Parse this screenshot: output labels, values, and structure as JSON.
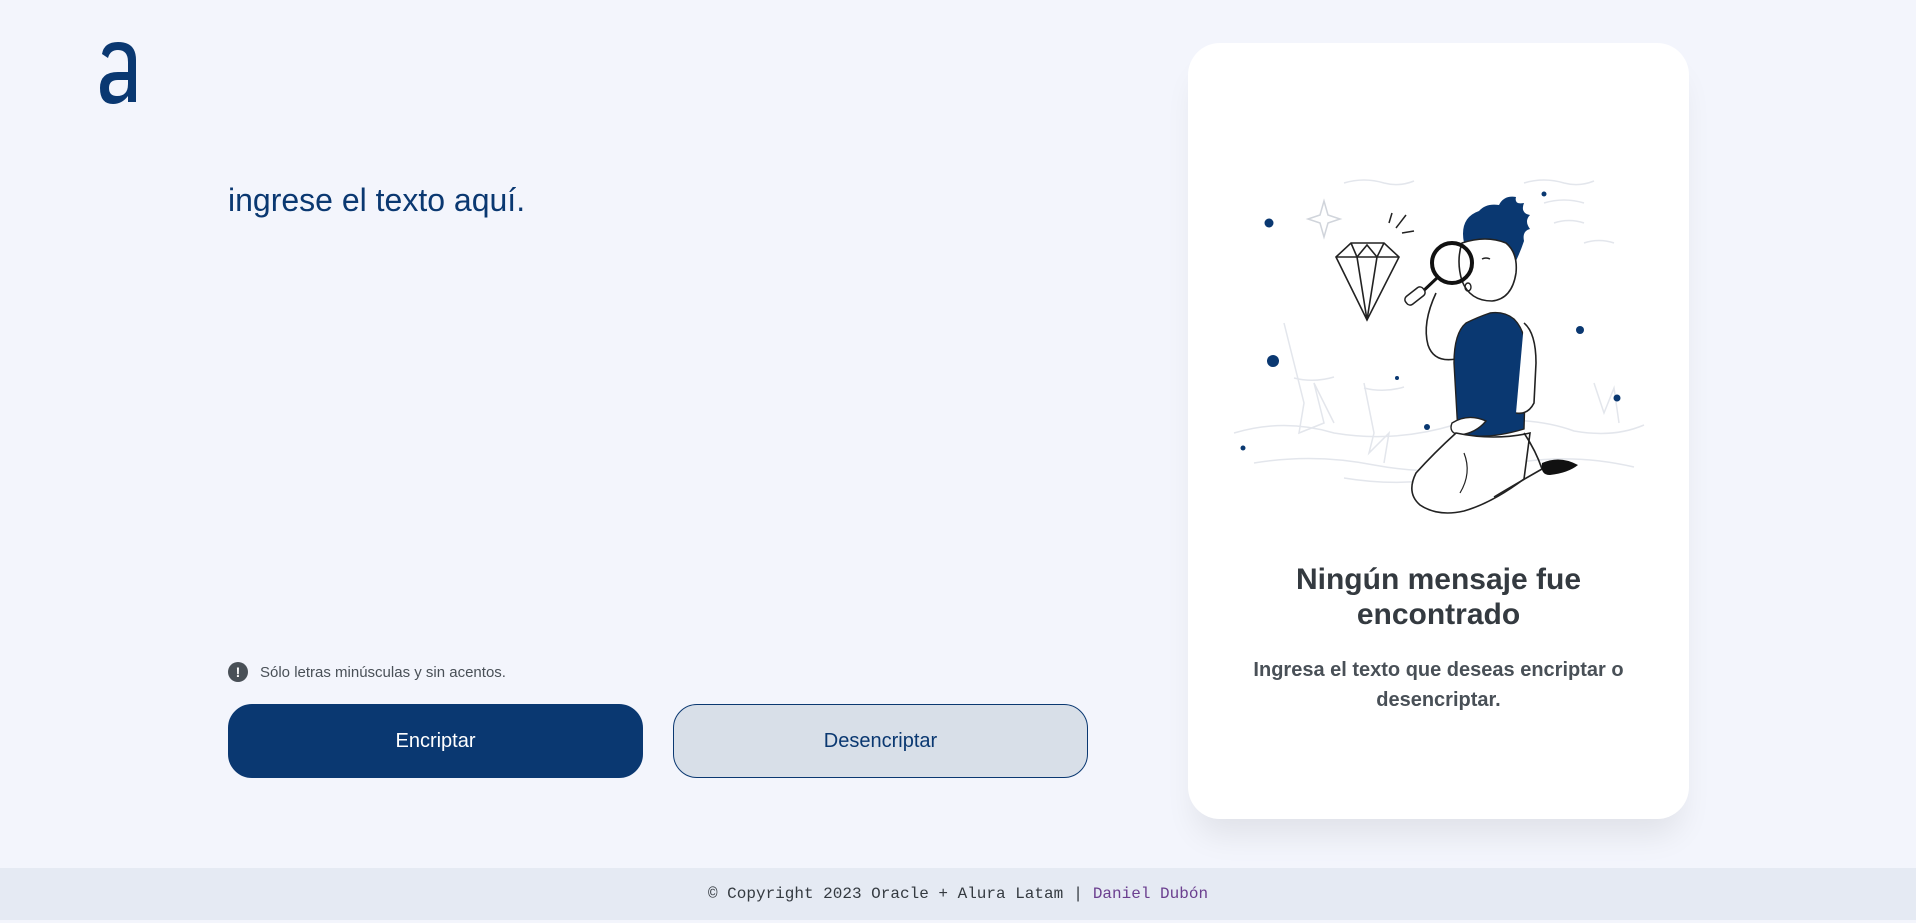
{
  "logo": {
    "icon": "alura-a-logo-icon",
    "color": "#0a3871"
  },
  "input": {
    "placeholder": "ingrese el texto aquí.",
    "value": ""
  },
  "hint": {
    "icon": "exclamation-icon",
    "text": "Sólo letras minúsculas y sin acentos."
  },
  "buttons": {
    "encrypt_label": "Encriptar",
    "decrypt_label": "Desencriptar"
  },
  "result": {
    "illustration": "person-with-magnifying-glass-and-diamond",
    "title": "Ningún mensaje fue encontrado",
    "description": "Ingresa el texto que deseas encriptar o desencriptar."
  },
  "footer": {
    "copyright": "© Copyright 2023 Oracle + Alura Latam",
    "separator": "|",
    "author": "Daniel Dubón"
  },
  "colors": {
    "background": "#f3f5fc",
    "primary": "#0a3871",
    "secondary_button": "#d8dfe8",
    "card": "#ffffff",
    "footer_bg": "#e5eaf3",
    "author_link": "#6b3f8f"
  }
}
